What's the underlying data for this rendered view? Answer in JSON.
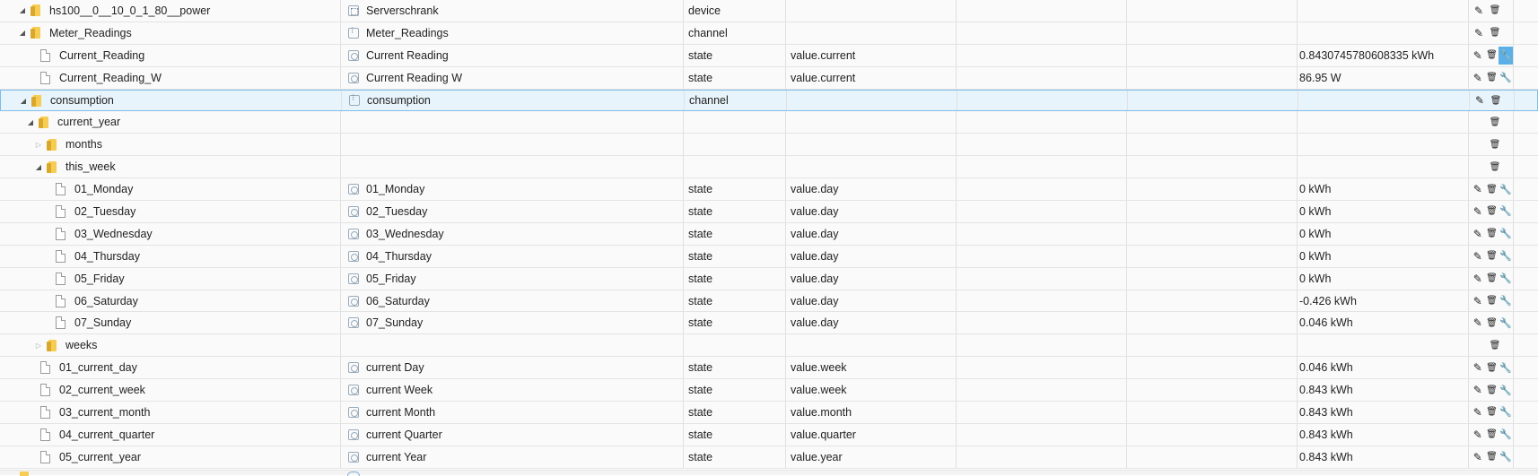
{
  "rows": [
    {
      "id": "hs100__0__10_0_1_80__power",
      "name": "Serverschrank",
      "type": "device",
      "role": "",
      "value": "",
      "icon": "folder-icon",
      "name_icon": "device-icon",
      "indent": 1,
      "expander": "expanded",
      "actions": [
        "edit",
        "delete"
      ]
    },
    {
      "id": "Meter_Readings",
      "name": "Meter_Readings",
      "type": "channel",
      "role": "",
      "value": "",
      "icon": "folder-icon",
      "name_icon": "channel-icon",
      "indent": 2,
      "expander": "expanded",
      "actions": [
        "edit",
        "delete"
      ]
    },
    {
      "id": "Current_Reading",
      "name": "Current Reading",
      "type": "state",
      "role": "value.current",
      "value": "0.8430745780608335 kWh",
      "icon": "file-icon",
      "name_icon": "state-icon",
      "indent": 3,
      "expander": "none",
      "actions": [
        "edit",
        "delete",
        "wrench-active"
      ]
    },
    {
      "id": "Current_Reading_W",
      "name": "Current Reading W",
      "type": "state",
      "role": "value.current",
      "value": "86.95 W",
      "icon": "file-icon",
      "name_icon": "state-icon",
      "indent": 3,
      "expander": "none",
      "actions": [
        "edit",
        "delete",
        "wrench"
      ]
    },
    {
      "id": "consumption",
      "name": "consumption",
      "type": "channel",
      "role": "",
      "value": "",
      "icon": "folder-icon",
      "name_icon": "channel-icon",
      "indent": 2,
      "expander": "expanded",
      "actions": [
        "edit",
        "delete"
      ],
      "selected": true
    },
    {
      "id": "current_year",
      "name": "",
      "type": "",
      "role": "",
      "value": "",
      "icon": "folder-icon",
      "name_icon": "",
      "indent": 3,
      "expander": "expanded",
      "actions": [
        "delete-only"
      ]
    },
    {
      "id": "months",
      "name": "",
      "type": "",
      "role": "",
      "value": "",
      "icon": "folder-icon",
      "name_icon": "",
      "indent": 4,
      "expander": "collapsed",
      "actions": [
        "delete-only"
      ]
    },
    {
      "id": "this_week",
      "name": "",
      "type": "",
      "role": "",
      "value": "",
      "icon": "folder-icon",
      "name_icon": "",
      "indent": 4,
      "expander": "expanded",
      "actions": [
        "delete-only"
      ]
    },
    {
      "id": "01_Monday",
      "name": "01_Monday",
      "type": "state",
      "role": "value.day",
      "value": "0 kWh",
      "icon": "file-icon",
      "name_icon": "state-icon",
      "indent": 5,
      "expander": "none",
      "actions": [
        "edit",
        "delete",
        "wrench"
      ]
    },
    {
      "id": "02_Tuesday",
      "name": "02_Tuesday",
      "type": "state",
      "role": "value.day",
      "value": "0 kWh",
      "icon": "file-icon",
      "name_icon": "state-icon",
      "indent": 5,
      "expander": "none",
      "actions": [
        "edit",
        "delete",
        "wrench"
      ]
    },
    {
      "id": "03_Wednesday",
      "name": "03_Wednesday",
      "type": "state",
      "role": "value.day",
      "value": "0 kWh",
      "icon": "file-icon",
      "name_icon": "state-icon",
      "indent": 5,
      "expander": "none",
      "actions": [
        "edit",
        "delete",
        "wrench"
      ]
    },
    {
      "id": "04_Thursday",
      "name": "04_Thursday",
      "type": "state",
      "role": "value.day",
      "value": "0 kWh",
      "icon": "file-icon",
      "name_icon": "state-icon",
      "indent": 5,
      "expander": "none",
      "actions": [
        "edit",
        "delete",
        "wrench"
      ]
    },
    {
      "id": "05_Friday",
      "name": "05_Friday",
      "type": "state",
      "role": "value.day",
      "value": "0 kWh",
      "icon": "file-icon",
      "name_icon": "state-icon",
      "indent": 5,
      "expander": "none",
      "actions": [
        "edit",
        "delete",
        "wrench"
      ]
    },
    {
      "id": "06_Saturday",
      "name": "06_Saturday",
      "type": "state",
      "role": "value.day",
      "value": "-0.426 kWh",
      "icon": "file-icon",
      "name_icon": "state-icon",
      "indent": 5,
      "expander": "none",
      "actions": [
        "edit",
        "delete",
        "wrench"
      ]
    },
    {
      "id": "07_Sunday",
      "name": "07_Sunday",
      "type": "state",
      "role": "value.day",
      "value": "0.046 kWh",
      "icon": "file-icon",
      "name_icon": "state-icon",
      "indent": 5,
      "expander": "none",
      "actions": [
        "edit",
        "delete",
        "wrench"
      ]
    },
    {
      "id": "weeks",
      "name": "",
      "type": "",
      "role": "",
      "value": "",
      "icon": "folder-icon",
      "name_icon": "",
      "indent": 4,
      "expander": "collapsed",
      "actions": [
        "delete-only"
      ]
    },
    {
      "id": "01_current_day",
      "name": "current Day",
      "type": "state",
      "role": "value.week",
      "value": "0.046 kWh",
      "icon": "file-icon",
      "name_icon": "state-icon",
      "indent": 3,
      "expander": "none",
      "actions": [
        "edit",
        "delete",
        "wrench"
      ]
    },
    {
      "id": "02_current_week",
      "name": "current Week",
      "type": "state",
      "role": "value.week",
      "value": "0.843 kWh",
      "icon": "file-icon",
      "name_icon": "state-icon",
      "indent": 3,
      "expander": "none",
      "actions": [
        "edit",
        "delete",
        "wrench"
      ]
    },
    {
      "id": "03_current_month",
      "name": "current Month",
      "type": "state",
      "role": "value.month",
      "value": "0.843 kWh",
      "icon": "file-icon",
      "name_icon": "state-icon",
      "indent": 3,
      "expander": "none",
      "actions": [
        "edit",
        "delete",
        "wrench"
      ]
    },
    {
      "id": "04_current_quarter",
      "name": "current Quarter",
      "type": "state",
      "role": "value.quarter",
      "value": "0.843 kWh",
      "icon": "file-icon",
      "name_icon": "state-icon",
      "indent": 3,
      "expander": "none",
      "actions": [
        "edit",
        "delete",
        "wrench"
      ]
    },
    {
      "id": "05_current_year",
      "name": "current Year",
      "type": "state",
      "role": "value.year",
      "value": "0.843 kWh",
      "icon": "file-icon",
      "name_icon": "state-icon",
      "indent": 3,
      "expander": "none",
      "actions": [
        "edit",
        "delete",
        "wrench"
      ]
    }
  ],
  "colors": {
    "selected_row": "#e8f4fb",
    "active_button": "#5bb0e8",
    "folder": "#f6cd52"
  }
}
